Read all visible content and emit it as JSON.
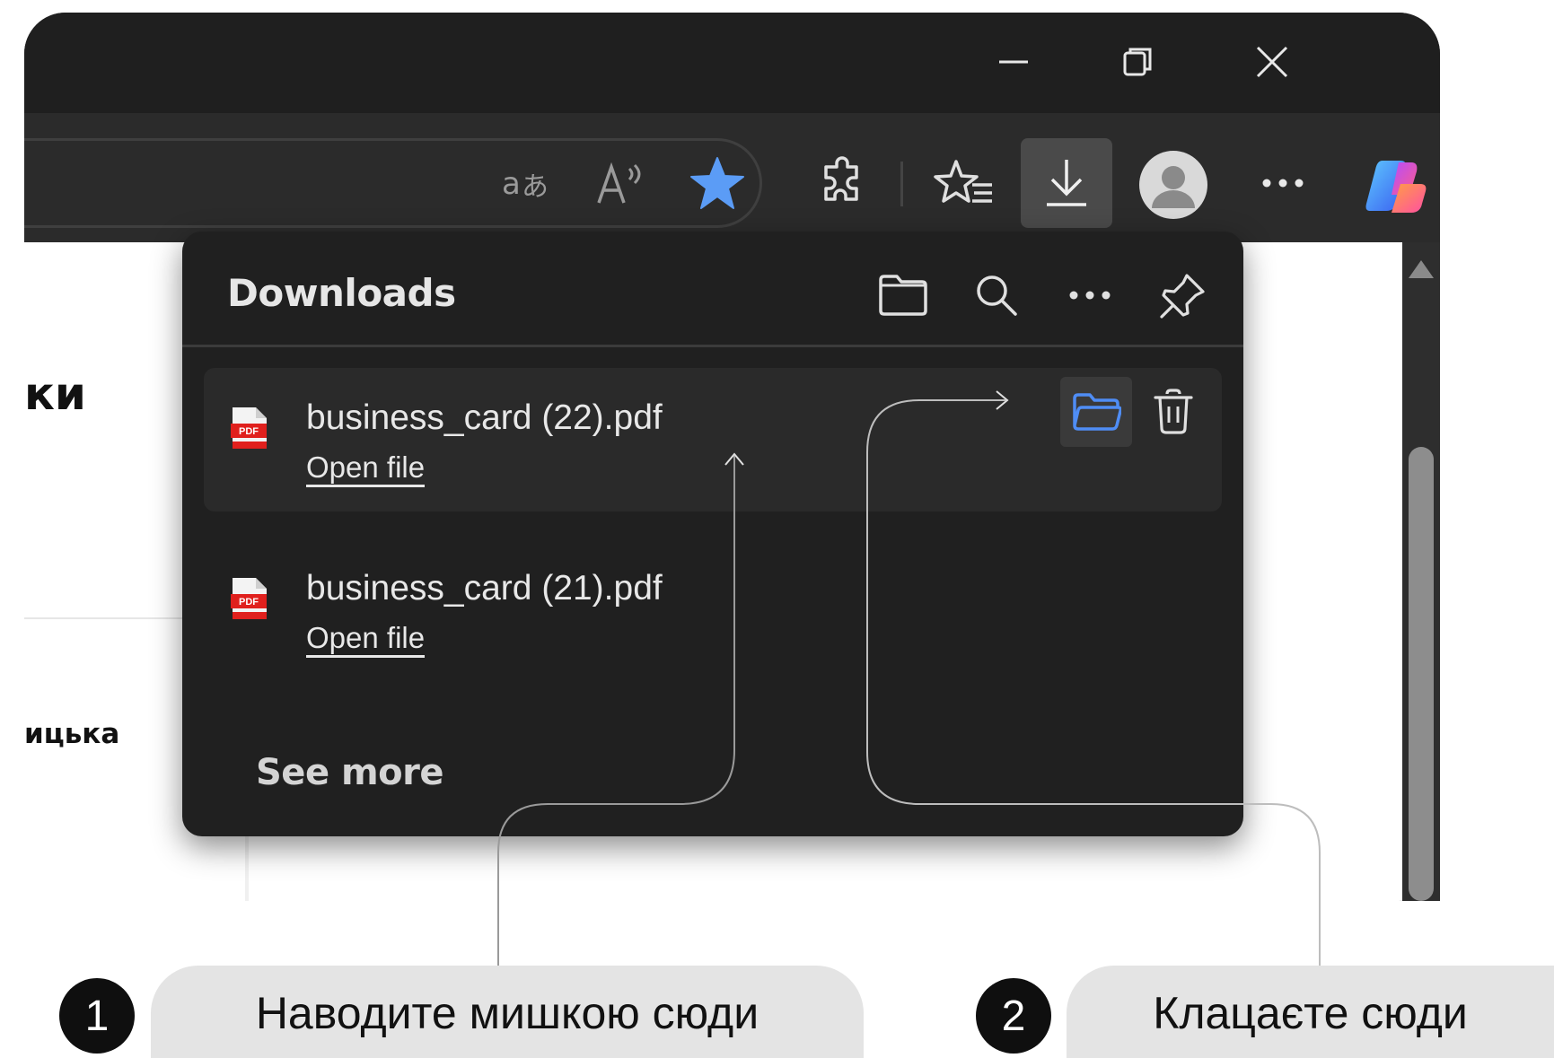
{
  "window_controls": {
    "minimize_icon": "minimize-icon",
    "restore_icon": "restore-icon",
    "close_icon": "close-icon"
  },
  "toolbar": {
    "translate_icon": "translate-icon",
    "read_aloud_icon": "read-aloud-icon",
    "favorite_star_icon": "star-filled-icon",
    "extensions_icon": "extensions-icon",
    "favorites_icon": "favorites-icon",
    "downloads_icon": "download-icon",
    "profile_icon": "avatar",
    "more_icon": "more-icon",
    "copilot_icon": "copilot-icon",
    "accent_color": "#4f8df5"
  },
  "page": {
    "heading_fragment": "ки",
    "sub_fragment": "ицька"
  },
  "downloads": {
    "title": "Downloads",
    "header_icons": [
      "folder-icon",
      "search-icon",
      "more-icon",
      "pin-icon"
    ],
    "items": [
      {
        "file_name": "business_card (22).pdf",
        "action": "Open file",
        "icon": "pdf-icon",
        "hovered": true
      },
      {
        "file_name": "business_card (21).pdf",
        "action": "Open file",
        "icon": "pdf-icon",
        "hovered": false
      }
    ],
    "item_actions": [
      "show-in-folder-icon",
      "delete-icon"
    ],
    "see_more": "See more"
  },
  "steps": [
    {
      "number": "1",
      "text": "Наводите мишкою сюди"
    },
    {
      "number": "2",
      "text": "Клацаєте сюди"
    }
  ]
}
